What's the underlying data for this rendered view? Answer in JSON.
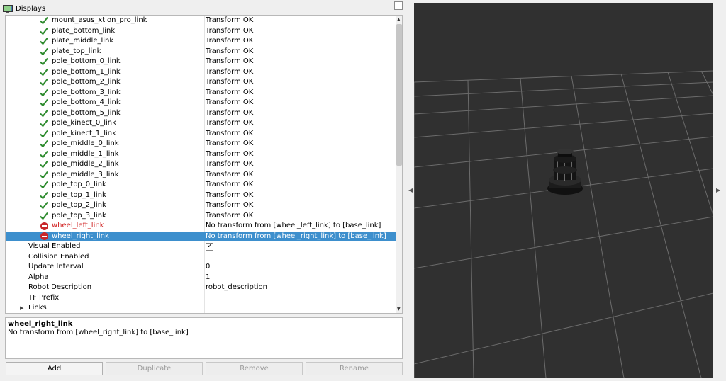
{
  "panel": {
    "title": "Displays",
    "icon": "monitor-icon"
  },
  "tree": {
    "rows": [
      {
        "name": "mount_asus_xtion_pro_link",
        "status": "ok",
        "value": "Transform OK"
      },
      {
        "name": "plate_bottom_link",
        "status": "ok",
        "value": "Transform OK"
      },
      {
        "name": "plate_middle_link",
        "status": "ok",
        "value": "Transform OK"
      },
      {
        "name": "plate_top_link",
        "status": "ok",
        "value": "Transform OK"
      },
      {
        "name": "pole_bottom_0_link",
        "status": "ok",
        "value": "Transform OK"
      },
      {
        "name": "pole_bottom_1_link",
        "status": "ok",
        "value": "Transform OK"
      },
      {
        "name": "pole_bottom_2_link",
        "status": "ok",
        "value": "Transform OK"
      },
      {
        "name": "pole_bottom_3_link",
        "status": "ok",
        "value": "Transform OK"
      },
      {
        "name": "pole_bottom_4_link",
        "status": "ok",
        "value": "Transform OK"
      },
      {
        "name": "pole_bottom_5_link",
        "status": "ok",
        "value": "Transform OK"
      },
      {
        "name": "pole_kinect_0_link",
        "status": "ok",
        "value": "Transform OK"
      },
      {
        "name": "pole_kinect_1_link",
        "status": "ok",
        "value": "Transform OK"
      },
      {
        "name": "pole_middle_0_link",
        "status": "ok",
        "value": "Transform OK"
      },
      {
        "name": "pole_middle_1_link",
        "status": "ok",
        "value": "Transform OK"
      },
      {
        "name": "pole_middle_2_link",
        "status": "ok",
        "value": "Transform OK"
      },
      {
        "name": "pole_middle_3_link",
        "status": "ok",
        "value": "Transform OK"
      },
      {
        "name": "pole_top_0_link",
        "status": "ok",
        "value": "Transform OK"
      },
      {
        "name": "pole_top_1_link",
        "status": "ok",
        "value": "Transform OK"
      },
      {
        "name": "pole_top_2_link",
        "status": "ok",
        "value": "Transform OK"
      },
      {
        "name": "pole_top_3_link",
        "status": "ok",
        "value": "Transform OK"
      },
      {
        "name": "wheel_left_link",
        "status": "error",
        "value": "No transform from [wheel_left_link] to [base_link]"
      },
      {
        "name": "wheel_right_link",
        "status": "error",
        "selected": true,
        "value": "No transform from [wheel_right_link] to [base_link]"
      }
    ],
    "properties": [
      {
        "name": "Visual Enabled",
        "type": "checkbox",
        "checked": true
      },
      {
        "name": "Collision Enabled",
        "type": "checkbox",
        "checked": false
      },
      {
        "name": "Update Interval",
        "value": "0"
      },
      {
        "name": "Alpha",
        "value": "1"
      },
      {
        "name": "Robot Description",
        "value": "robot_description"
      },
      {
        "name": "TF Prefix",
        "value": ""
      },
      {
        "name": "Links",
        "expandable": true,
        "value": ""
      }
    ]
  },
  "description": {
    "title": "wheel_right_link",
    "text": "No transform from [wheel_right_link] to [base_link]"
  },
  "buttons": {
    "add": "Add",
    "duplicate": "Duplicate",
    "remove": "Remove",
    "rename": "Rename"
  },
  "colors": {
    "selection": "#3d8fcd",
    "error": "#d02020",
    "ok_check": "#2e8b2e",
    "viewport_bg": "#303030",
    "grid": "#6c6c6c"
  }
}
